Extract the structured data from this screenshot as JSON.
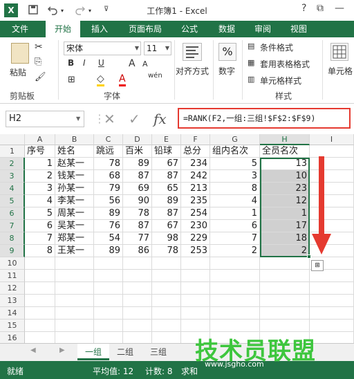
{
  "window": {
    "title": "工作簿1 - Excel",
    "minimize": "—",
    "question": "?",
    "restore": "⧉"
  },
  "quick_access": {
    "save_icon": "save-icon",
    "undo_icon": "undo-icon",
    "redo_icon": "redo-icon"
  },
  "ribbon_tabs": [
    "文件",
    "开始",
    "插入",
    "页面布局",
    "公式",
    "数据",
    "审阅",
    "视图"
  ],
  "ribbon": {
    "clipboard": {
      "paste": "粘贴",
      "label": "剪贴板"
    },
    "font": {
      "name": "宋体",
      "size": "11",
      "bold": "B",
      "italic": "I",
      "underline": "U",
      "grow": "A",
      "shrink": "A",
      "wen": "wén",
      "label": "字体"
    },
    "alignment": {
      "label": "对齐方式"
    },
    "number": {
      "symbol": "%",
      "label": "数字"
    },
    "styles": {
      "conditional": "条件格式",
      "table": "套用表格格式",
      "cell": "单元格样式",
      "label": "样式"
    },
    "cells": {
      "label": "单元格"
    }
  },
  "formula_bar": {
    "name_box": "H2",
    "cancel": "✕",
    "confirm": "✓",
    "fx": "fx",
    "formula": "=RANK(F2,一组:三组!$F$2:$F$9)"
  },
  "columns": [
    "A",
    "B",
    "C",
    "D",
    "E",
    "F",
    "G",
    "H",
    "I"
  ],
  "rows": [
    "1",
    "2",
    "3",
    "4",
    "5",
    "6",
    "7",
    "8",
    "9",
    "10",
    "11",
    "12",
    "13",
    "14",
    "15",
    "16"
  ],
  "table": {
    "headers": [
      "序号",
      "姓名",
      "跳远",
      "百米",
      "铅球",
      "总分",
      "组内名次",
      "全员名次"
    ],
    "data": [
      [
        "1",
        "赵某一",
        "78",
        "89",
        "67",
        "234",
        "5",
        "13"
      ],
      [
        "2",
        "钱某一",
        "68",
        "87",
        "87",
        "242",
        "3",
        "10"
      ],
      [
        "3",
        "孙某一",
        "79",
        "69",
        "65",
        "213",
        "8",
        "23"
      ],
      [
        "4",
        "李某一",
        "56",
        "90",
        "89",
        "235",
        "4",
        "12"
      ],
      [
        "5",
        "周某一",
        "89",
        "78",
        "87",
        "254",
        "1",
        "1"
      ],
      [
        "6",
        "吴某一",
        "76",
        "87",
        "67",
        "230",
        "6",
        "17"
      ],
      [
        "7",
        "郑某一",
        "54",
        "77",
        "98",
        "229",
        "7",
        "18"
      ],
      [
        "8",
        "王某一",
        "89",
        "86",
        "78",
        "253",
        "2",
        "2"
      ]
    ]
  },
  "sheets": [
    "一组",
    "二组",
    "三组"
  ],
  "status": {
    "ready": "就绪",
    "average": "平均值: 12",
    "count": "计数: 8",
    "sum": "求和"
  },
  "watermark": {
    "text": "技术员联盟",
    "url": "www.jsgho.com"
  },
  "colors": {
    "accent": "#217346",
    "highlight": "#e53a30",
    "selection": "#d0d0d0"
  }
}
